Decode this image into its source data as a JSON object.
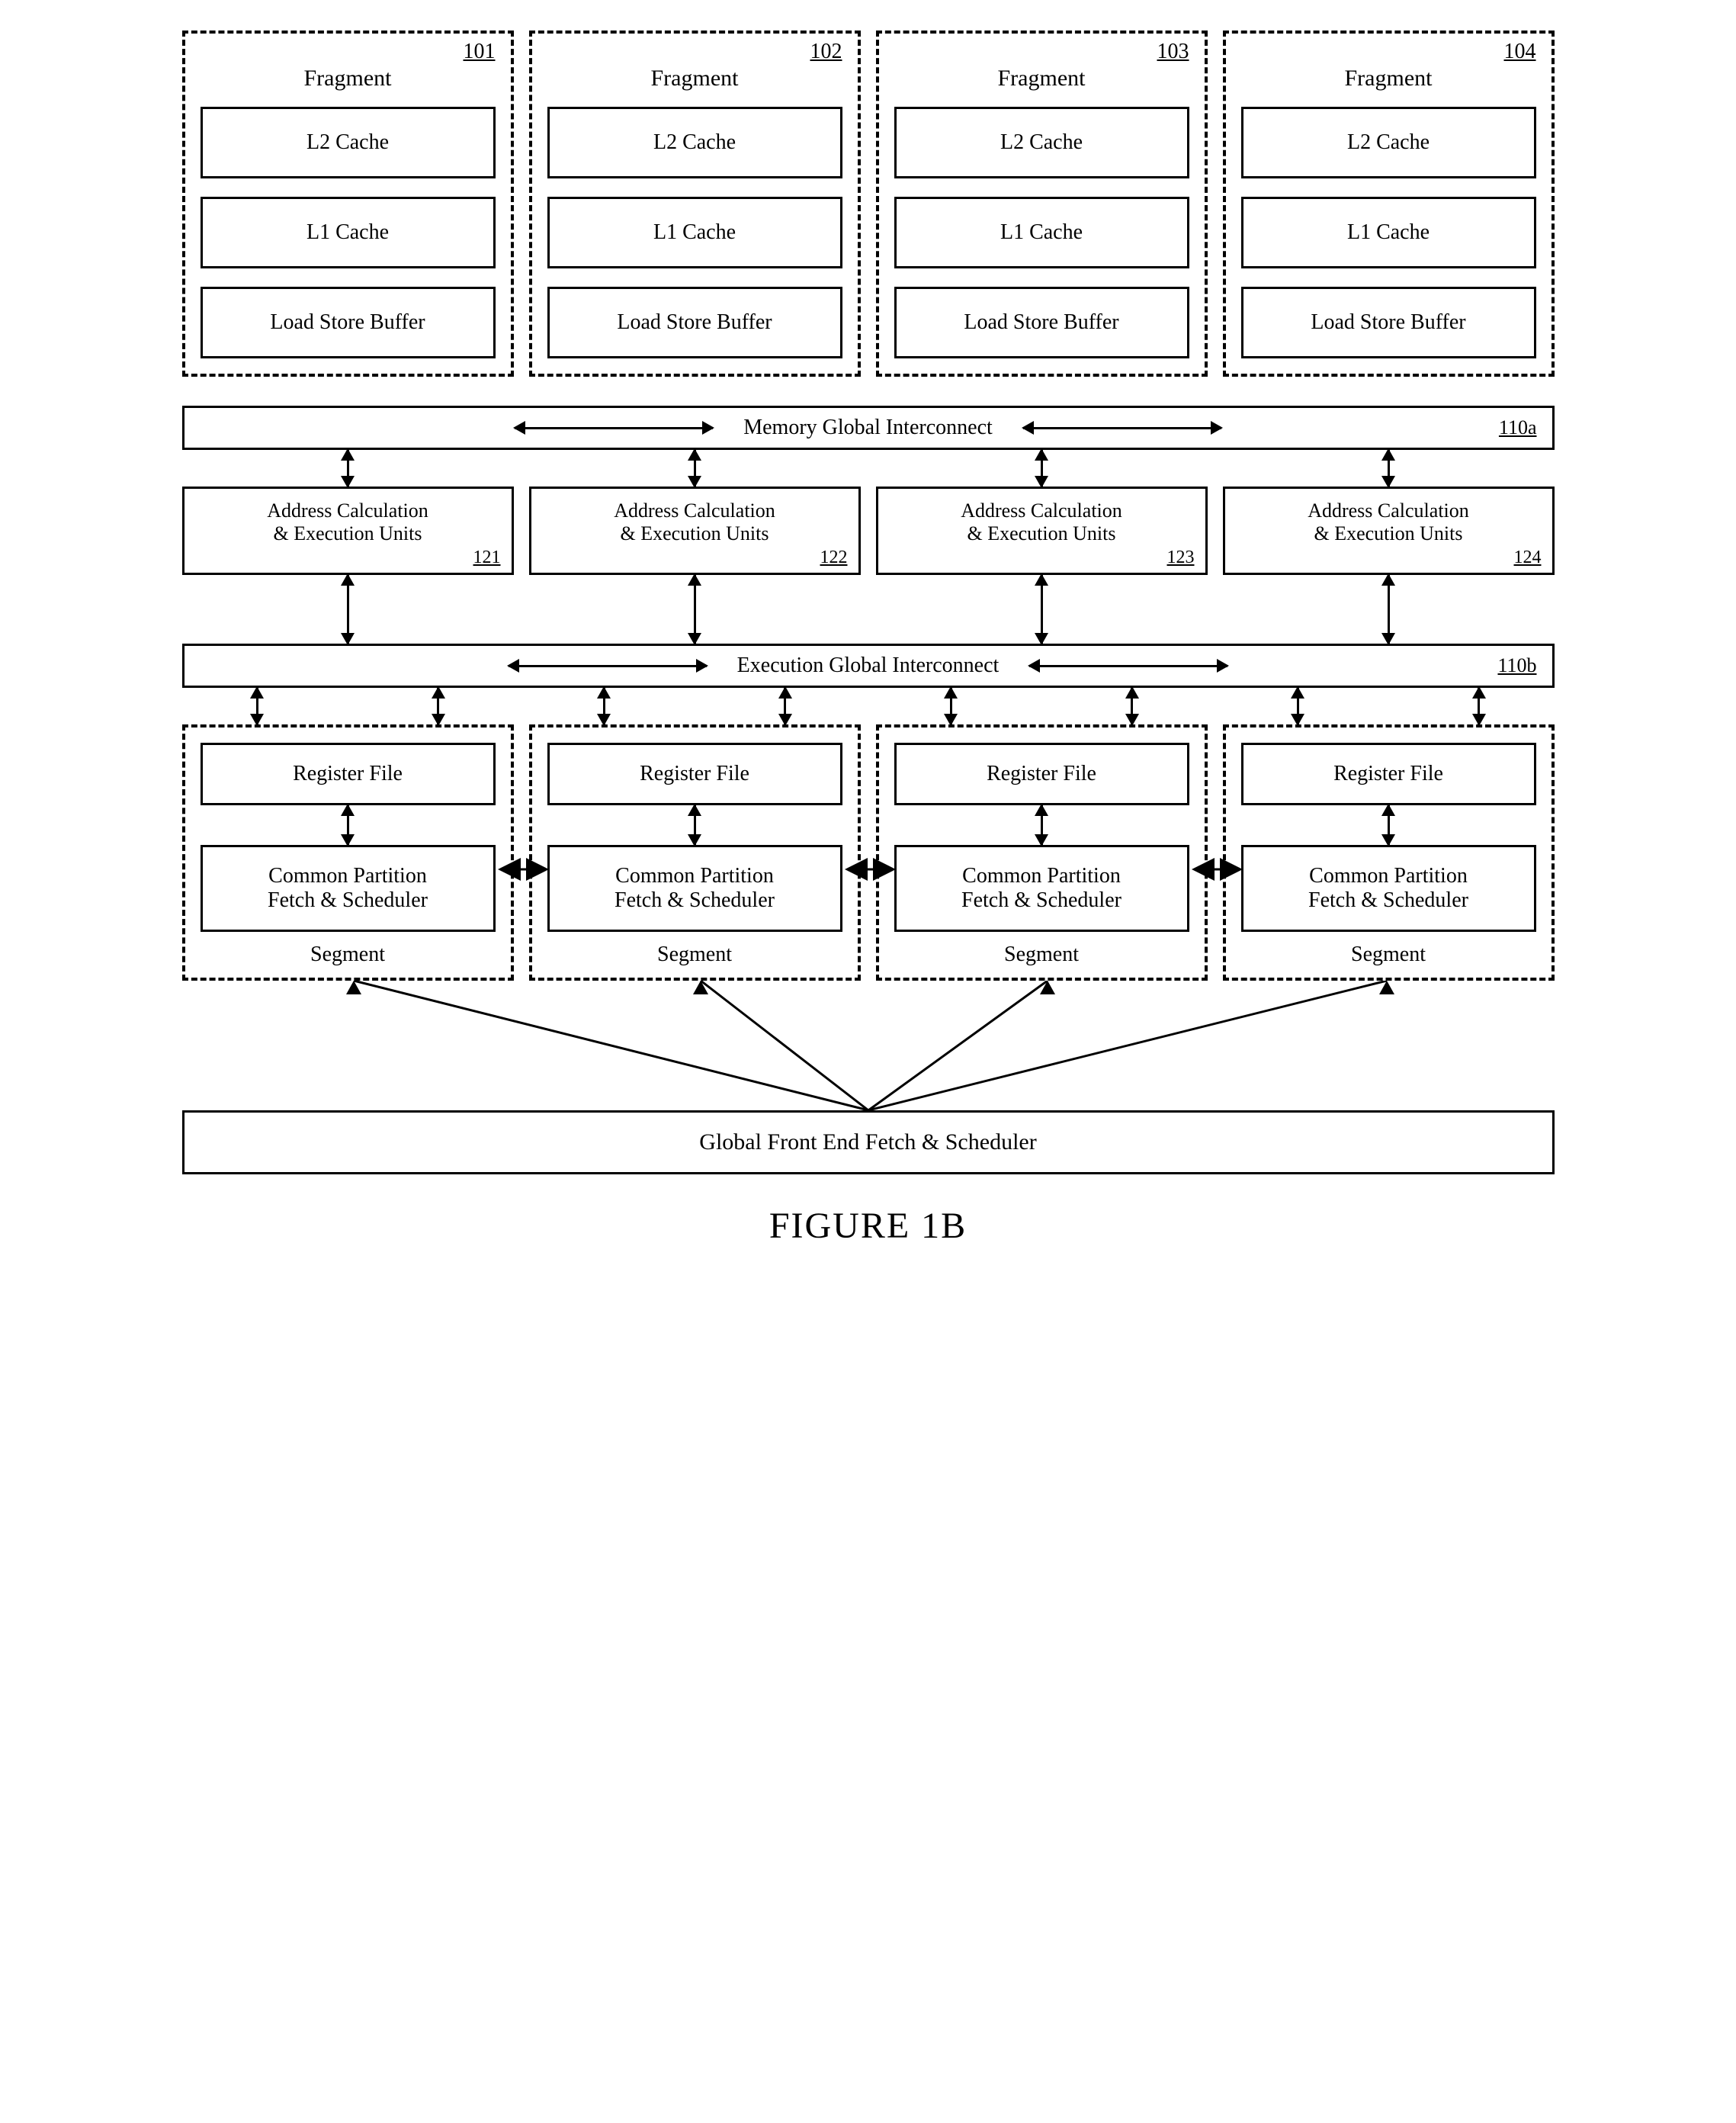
{
  "figure_label": "FIGURE 1B",
  "fragments": [
    {
      "ref": "101",
      "title": "Fragment",
      "boxes": [
        "L2 Cache",
        "L1 Cache",
        "Load Store Buffer"
      ]
    },
    {
      "ref": "102",
      "title": "Fragment",
      "boxes": [
        "L2 Cache",
        "L1 Cache",
        "Load Store Buffer"
      ]
    },
    {
      "ref": "103",
      "title": "Fragment",
      "boxes": [
        "L2 Cache",
        "L1 Cache",
        "Load Store Buffer"
      ]
    },
    {
      "ref": "104",
      "title": "Fragment",
      "boxes": [
        "L2 Cache",
        "L1 Cache",
        "Load Store Buffer"
      ]
    }
  ],
  "memory_interconnect": {
    "label": "Memory Global Interconnect",
    "ref": "110a"
  },
  "addr_units": [
    {
      "line1": "Address Calculation",
      "line2": "& Execution Units",
      "ref": "121"
    },
    {
      "line1": "Address Calculation",
      "line2": "& Execution Units",
      "ref": "122"
    },
    {
      "line1": "Address Calculation",
      "line2": "& Execution Units",
      "ref": "123"
    },
    {
      "line1": "Address Calculation",
      "line2": "& Execution Units",
      "ref": "124"
    }
  ],
  "exec_interconnect": {
    "label": "Execution Global Interconnect",
    "ref": "110b"
  },
  "segments": [
    {
      "reg": "Register File",
      "sched_l1": "Common Partition",
      "sched_l2": "Fetch & Scheduler",
      "label": "Segment"
    },
    {
      "reg": "Register File",
      "sched_l1": "Common Partition",
      "sched_l2": "Fetch & Scheduler",
      "label": "Segment"
    },
    {
      "reg": "Register File",
      "sched_l1": "Common Partition",
      "sched_l2": "Fetch & Scheduler",
      "label": "Segment"
    },
    {
      "reg": "Register File",
      "sched_l1": "Common Partition",
      "sched_l2": "Fetch & Scheduler",
      "label": "Segment"
    }
  ],
  "global_front_end": "Global Front End Fetch & Scheduler"
}
